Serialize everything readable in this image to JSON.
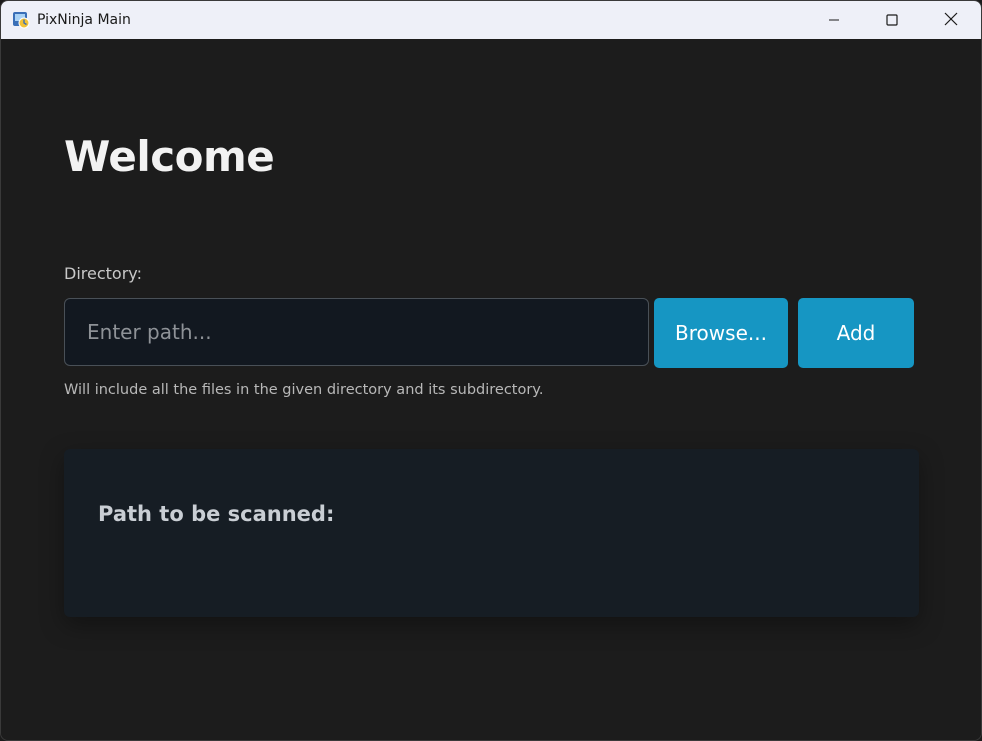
{
  "window": {
    "title": "PixNinja Main",
    "controls": {
      "minimize_icon": "minimize-icon",
      "maximize_icon": "maximize-icon",
      "close_icon": "close-icon"
    }
  },
  "main": {
    "heading": "Welcome",
    "directory_label": "Directory:",
    "path_input": {
      "value": "",
      "placeholder": "Enter path..."
    },
    "browse_label": "Browse...",
    "add_label": "Add",
    "help_text": "Will include all the files in the given directory and its subdirectory.",
    "scan_panel": {
      "title": "Path to be scanned:"
    }
  },
  "colors": {
    "background": "#1c1c1c",
    "titlebar": "#eef0f8",
    "accent": "#1696c3",
    "input_bg": "#121820",
    "panel_bg": "#161d24"
  }
}
